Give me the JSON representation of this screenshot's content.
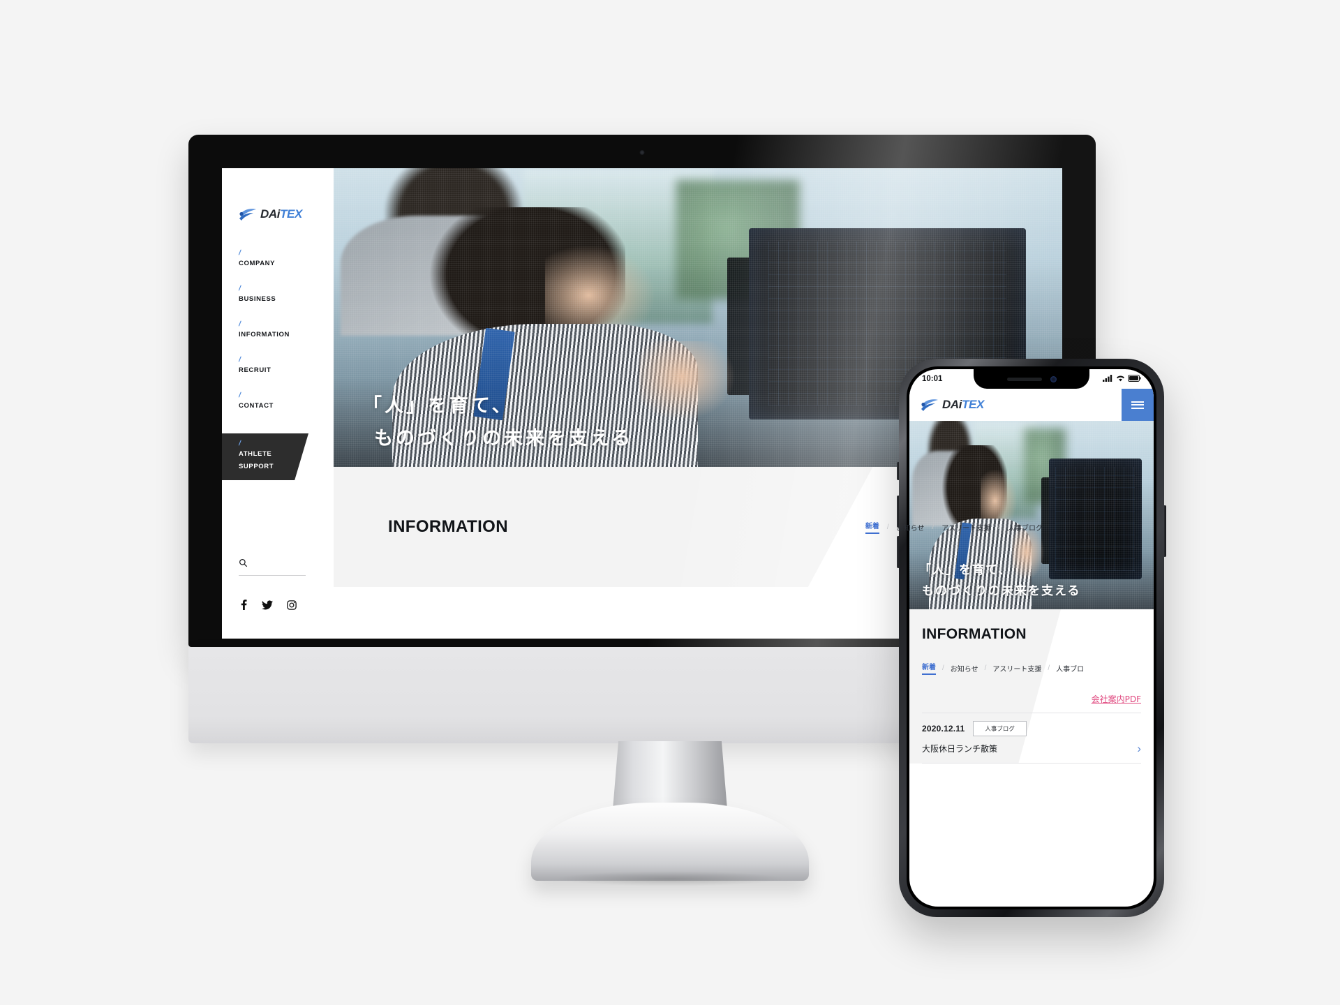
{
  "brand": {
    "name_part1": "DAi",
    "name_part2": "TEX",
    "logo_icon": "swoosh-wave-icon",
    "accent_blue": "#3f7fd6",
    "accent_link_pink": "#e0487f"
  },
  "desktop": {
    "sidebar": {
      "nav_marker": "/",
      "items": [
        {
          "label": "COMPANY"
        },
        {
          "label": "BUSINESS"
        },
        {
          "label": "INFORMATION"
        },
        {
          "label": "RECRUIT"
        },
        {
          "label": "CONTACT"
        }
      ],
      "highlight_item": {
        "label_line1": "ATHLETE",
        "label_line2": "SUPPORT"
      },
      "search_icon": "search-icon",
      "social": [
        {
          "name": "facebook-icon"
        },
        {
          "name": "twitter-icon"
        },
        {
          "name": "instagram-icon"
        }
      ]
    },
    "hero": {
      "headline_line1": "「人」を育て、",
      "headline_line2": "ものづくりの未来を支える"
    },
    "information": {
      "title": "INFORMATION",
      "separator": "/",
      "tabs": [
        {
          "label": "新着",
          "active": true
        },
        {
          "label": "お知らせ",
          "active": false
        },
        {
          "label": "アスリート支援",
          "active": false
        },
        {
          "label": "人事ブログ",
          "active": false
        }
      ]
    }
  },
  "phone": {
    "status": {
      "time": "10:01",
      "signal_icon": "cellular-signal-icon",
      "wifi_icon": "wifi-icon",
      "battery_icon": "battery-icon"
    },
    "header": {
      "menu_icon": "hamburger-menu-icon"
    },
    "hero": {
      "headline_line1": "「人」を育て、",
      "headline_line2": "ものづくりの未来を支える"
    },
    "information": {
      "title": "INFORMATION",
      "separator": "/",
      "tabs": [
        {
          "label": "新着",
          "active": true
        },
        {
          "label": "お知らせ",
          "active": false
        },
        {
          "label": "アスリート支援",
          "active": false
        },
        {
          "label": "人事ブロ",
          "active": false
        }
      ],
      "pdf_link": "会社案内PDF",
      "rows": [
        {
          "date": "2020.12.11",
          "category": "人事ブログ",
          "title": "大阪休日ランチ散策",
          "chevron": "›"
        }
      ]
    }
  }
}
